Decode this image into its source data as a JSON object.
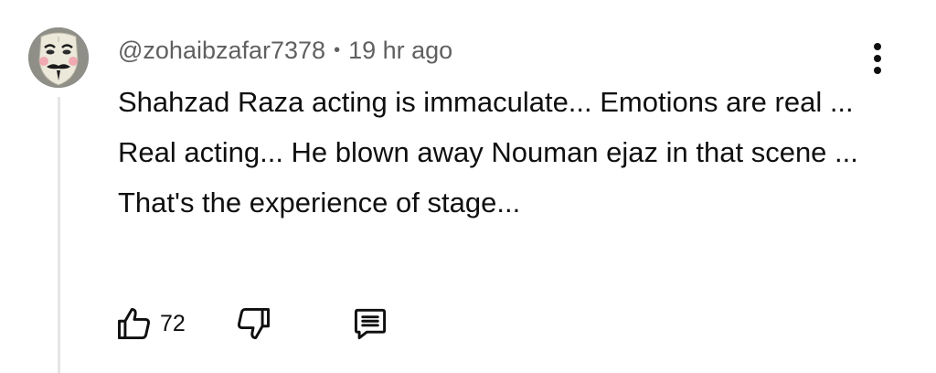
{
  "comment": {
    "author": "@zohaibzafar7378",
    "separator": "•",
    "time": "19 hr ago",
    "text": "Shahzad Raza acting is immaculate... Emotions are real ... Real acting... He blown away Nouman ejaz in that scene ... That's the experience of stage...",
    "likes": "72"
  },
  "icons": {
    "avatar": "guy-fawkes-mask-avatar",
    "menu": "more-vert-icon",
    "like": "thumbs-up-icon",
    "dislike": "thumbs-down-icon",
    "reply": "comment-reply-icon"
  },
  "colors": {
    "text_primary": "#0f0f0f",
    "text_secondary": "#606060",
    "thread_line": "#e5e5e5"
  }
}
